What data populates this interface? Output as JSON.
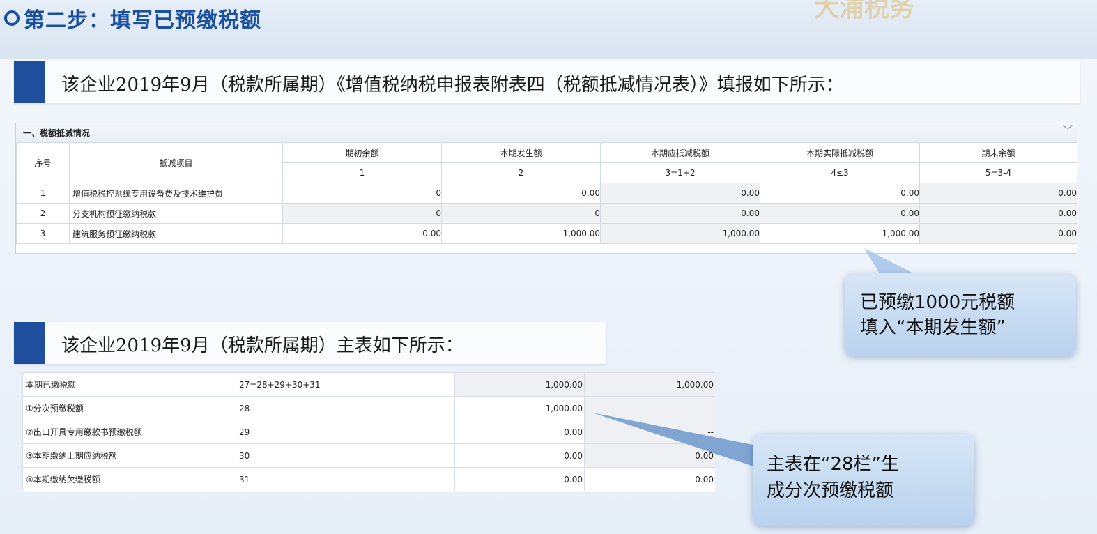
{
  "header": {
    "step_title": "第二步：填写已预缴税额",
    "watermark": "大浦税务"
  },
  "banner1": {
    "text": "该企业2019年9月（税款所属期）《增值税纳税申报表附表四（税额抵减情况表）》填报如下所示："
  },
  "banner2": {
    "text": "该企业2019年9月（税款所属期）主表如下所示："
  },
  "table1": {
    "section_title": "一、税额抵减情况",
    "headers": {
      "seq": "序号",
      "item": "抵减项目",
      "cols": [
        "期初余额",
        "本期发生额",
        "本期应抵减税额",
        "本期实际抵减税额",
        "期末余额"
      ],
      "col_nums": [
        "1",
        "2",
        "3=1+2",
        "4≤3",
        "5=3-4"
      ]
    },
    "rows": [
      {
        "seq": "1",
        "item": "增值税税控系统专用设备费及技术维护费",
        "v": [
          "0",
          "0.00",
          "0.00",
          "0.00",
          "0.00"
        ]
      },
      {
        "seq": "2",
        "item": "分支机构预征缴纳税款",
        "v": [
          "0",
          "0",
          "0.00",
          "0.00",
          "0.00"
        ]
      },
      {
        "seq": "3",
        "item": "建筑服务预征缴纳税款",
        "v": [
          "0.00",
          "1,000.00",
          "1,000.00",
          "1,000.00",
          "0.00"
        ]
      }
    ]
  },
  "table2": {
    "rows": [
      {
        "label": "本期已缴税额",
        "col": "27=28+29+30+31",
        "a": "1,000.00",
        "b": "1,000.00"
      },
      {
        "label": "①分次预缴税额",
        "col": "28",
        "a": "1,000.00",
        "b": "--"
      },
      {
        "label": "②出口开具专用缴款书预缴税额",
        "col": "29",
        "a": "0.00",
        "b": "--"
      },
      {
        "label": "③本期缴纳上期应纳税额",
        "col": "30",
        "a": "0.00",
        "b": "0.00"
      },
      {
        "label": "④本期缴纳欠缴税额",
        "col": "31",
        "a": "0.00",
        "b": "0.00"
      }
    ]
  },
  "callout1": {
    "line1": "已预缴1000元税额",
    "line2": "填入“本期发生额”"
  },
  "callout2": {
    "line1": "主表在“28栏”生",
    "line2": "成分次预缴税额"
  },
  "colors": {
    "accent": "#1f4f9c",
    "callout": "#c4dbf2"
  },
  "icons": {
    "collapse": "chevron-down-icon",
    "step_marker": "circle-icon"
  }
}
